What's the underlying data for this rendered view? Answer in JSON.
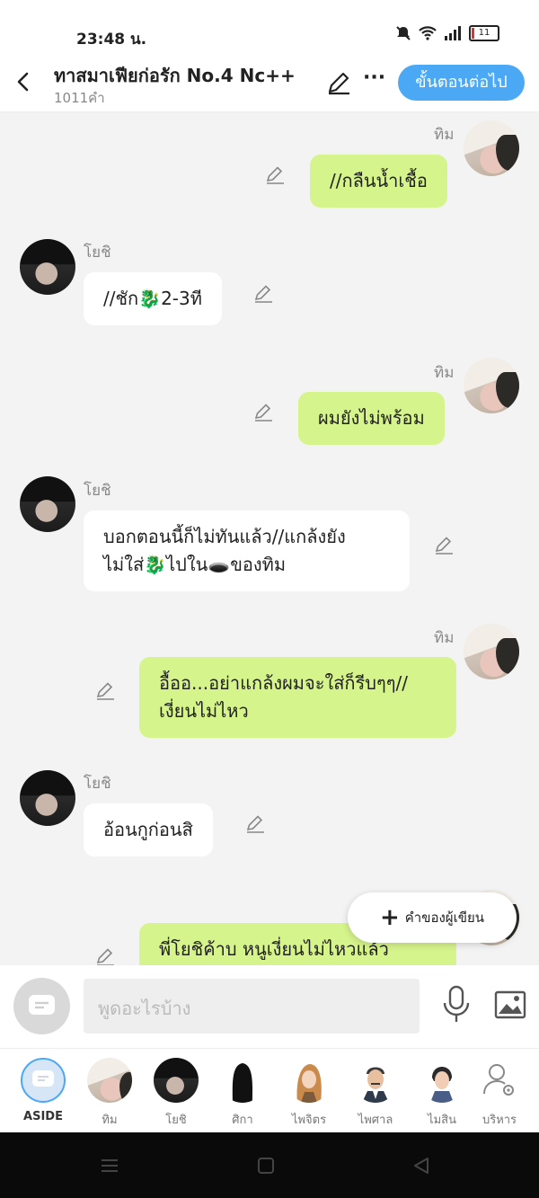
{
  "status": {
    "time": "23:48 น.",
    "battery": "11"
  },
  "header": {
    "title": "ทาสมาเฟียก่อรัก No.4 Nc++",
    "word_count": "1011คำ",
    "next_button": "ขั้นตอนต่อไป"
  },
  "messages": [
    {
      "sender": "ทิม",
      "side": "right",
      "text": "//กลืนน้ำเชื้อ"
    },
    {
      "sender": "โยชิ",
      "side": "left",
      "text": "//ชัก🐉2-3ที"
    },
    {
      "sender": "ทิม",
      "side": "right",
      "text": "ผมยังไม่พร้อม"
    },
    {
      "sender": "โยชิ",
      "side": "left",
      "line1": "บอกตอนนี้ก็ไม่ทันแล้ว//แกล้งยัง",
      "line2": "ไม่ใส่🐉ไปใน🕳️ของทิม"
    },
    {
      "sender": "ทิม",
      "side": "right",
      "line1": "อื้ออ...อย่าแกล้งผมจะใส่ก็รีบๆๆ//",
      "line2": "เงี่ยนไม่ไหว"
    },
    {
      "sender": "โยชิ",
      "side": "left",
      "text": "อ้อนกูก่อนสิ"
    },
    {
      "sender": "ทิม",
      "side": "right",
      "text": "พี่โยชิค้าบ หนูเงี่ยนไม่ไหวแล้ว"
    }
  ],
  "author_button": "คำของผู้เขียน",
  "input": {
    "placeholder": "พูดอะไรบ้าง"
  },
  "tabs": [
    "ASIDE",
    "ทิม",
    "โยชิ",
    "ศิกา",
    "ไพจิตร",
    "ไพศาล",
    "ไมสิน",
    "บริหาร"
  ],
  "colors": {
    "accent": "#4aa8f5",
    "my_bubble": "#d6f48c",
    "other_bubble": "#ffffff"
  }
}
